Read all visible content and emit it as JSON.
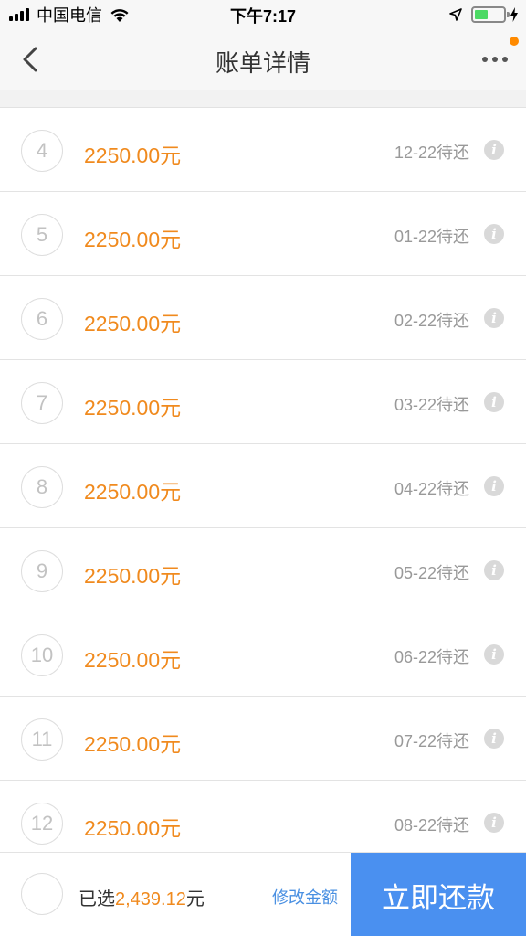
{
  "status_bar": {
    "carrier": "中国电信",
    "time": "下午7:17",
    "battery_color": "#4cd964"
  },
  "nav": {
    "title": "账单详情",
    "back_icon": "chevron-left-icon",
    "more_icon": "more-horizontal-icon",
    "notification_color": "#ff8a00"
  },
  "installments": [
    {
      "period": "4",
      "amount": "2250.00元",
      "due": "12-22待还"
    },
    {
      "period": "5",
      "amount": "2250.00元",
      "due": "01-22待还"
    },
    {
      "period": "6",
      "amount": "2250.00元",
      "due": "02-22待还"
    },
    {
      "period": "7",
      "amount": "2250.00元",
      "due": "03-22待还"
    },
    {
      "period": "8",
      "amount": "2250.00元",
      "due": "04-22待还"
    },
    {
      "period": "9",
      "amount": "2250.00元",
      "due": "05-22待还"
    },
    {
      "period": "10",
      "amount": "2250.00元",
      "due": "06-22待还"
    },
    {
      "period": "11",
      "amount": "2250.00元",
      "due": "07-22待还"
    },
    {
      "period": "12",
      "amount": "2250.00元",
      "due": "08-22待还"
    }
  ],
  "info_icon_glyph": "i",
  "bottom": {
    "selected_prefix": "已选",
    "selected_amount": "2,439.12",
    "selected_suffix": "元",
    "modify_label": "修改金额",
    "pay_label": "立即还款"
  },
  "colors": {
    "accent_orange": "#f08a1e",
    "link_blue": "#4a90e2",
    "pay_button": "#4a90f0"
  }
}
